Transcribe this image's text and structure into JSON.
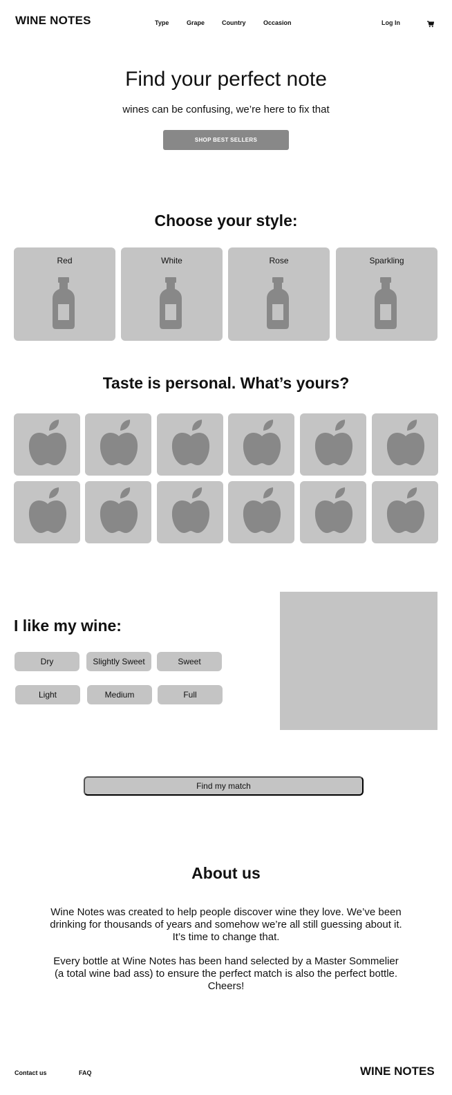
{
  "header": {
    "logo": "WINE NOTES",
    "nav": [
      "Type",
      "Grape",
      "Country",
      "Occasion"
    ],
    "login": "Log In",
    "cart_icon": "cart-icon"
  },
  "hero": {
    "title": "Find your perfect note",
    "subtitle": "wines can be confusing, we’re here to fix that",
    "button": "SHOP BEST SELLERS"
  },
  "styles": {
    "title": "Choose your style:",
    "items": [
      "Red",
      "White",
      "Rose",
      "Sparkling"
    ],
    "icon": "wine-bottle-icon"
  },
  "taste": {
    "title": "Taste is personal. What’s yours?",
    "icon": "apple-icon",
    "count": 12
  },
  "like": {
    "title": "I like my wine:",
    "sweetness": [
      "Dry",
      "Slightly Sweet",
      "Sweet"
    ],
    "body": [
      "Light",
      "Medium",
      "Full"
    ]
  },
  "match_button": "Find my match",
  "about": {
    "title": "About us",
    "p1": "Wine Notes was created to help people discover wine they love. We’ve been drinking for thousands of years and somehow we’re all still guessing about it. It’s time to change that.",
    "p2": "Every bottle at Wine Notes has been hand selected by a Master Sommelier (a total wine bad ass) to ensure the perfect match is also the perfect bottle. Cheers!"
  },
  "footer": {
    "contact": "Contact us",
    "faq": "FAQ",
    "logo": "WINE NOTES"
  },
  "colors": {
    "card_bg": "#c4c4c4",
    "icon_fill": "#888888",
    "button_bg": "#888888",
    "text": "#111111"
  }
}
